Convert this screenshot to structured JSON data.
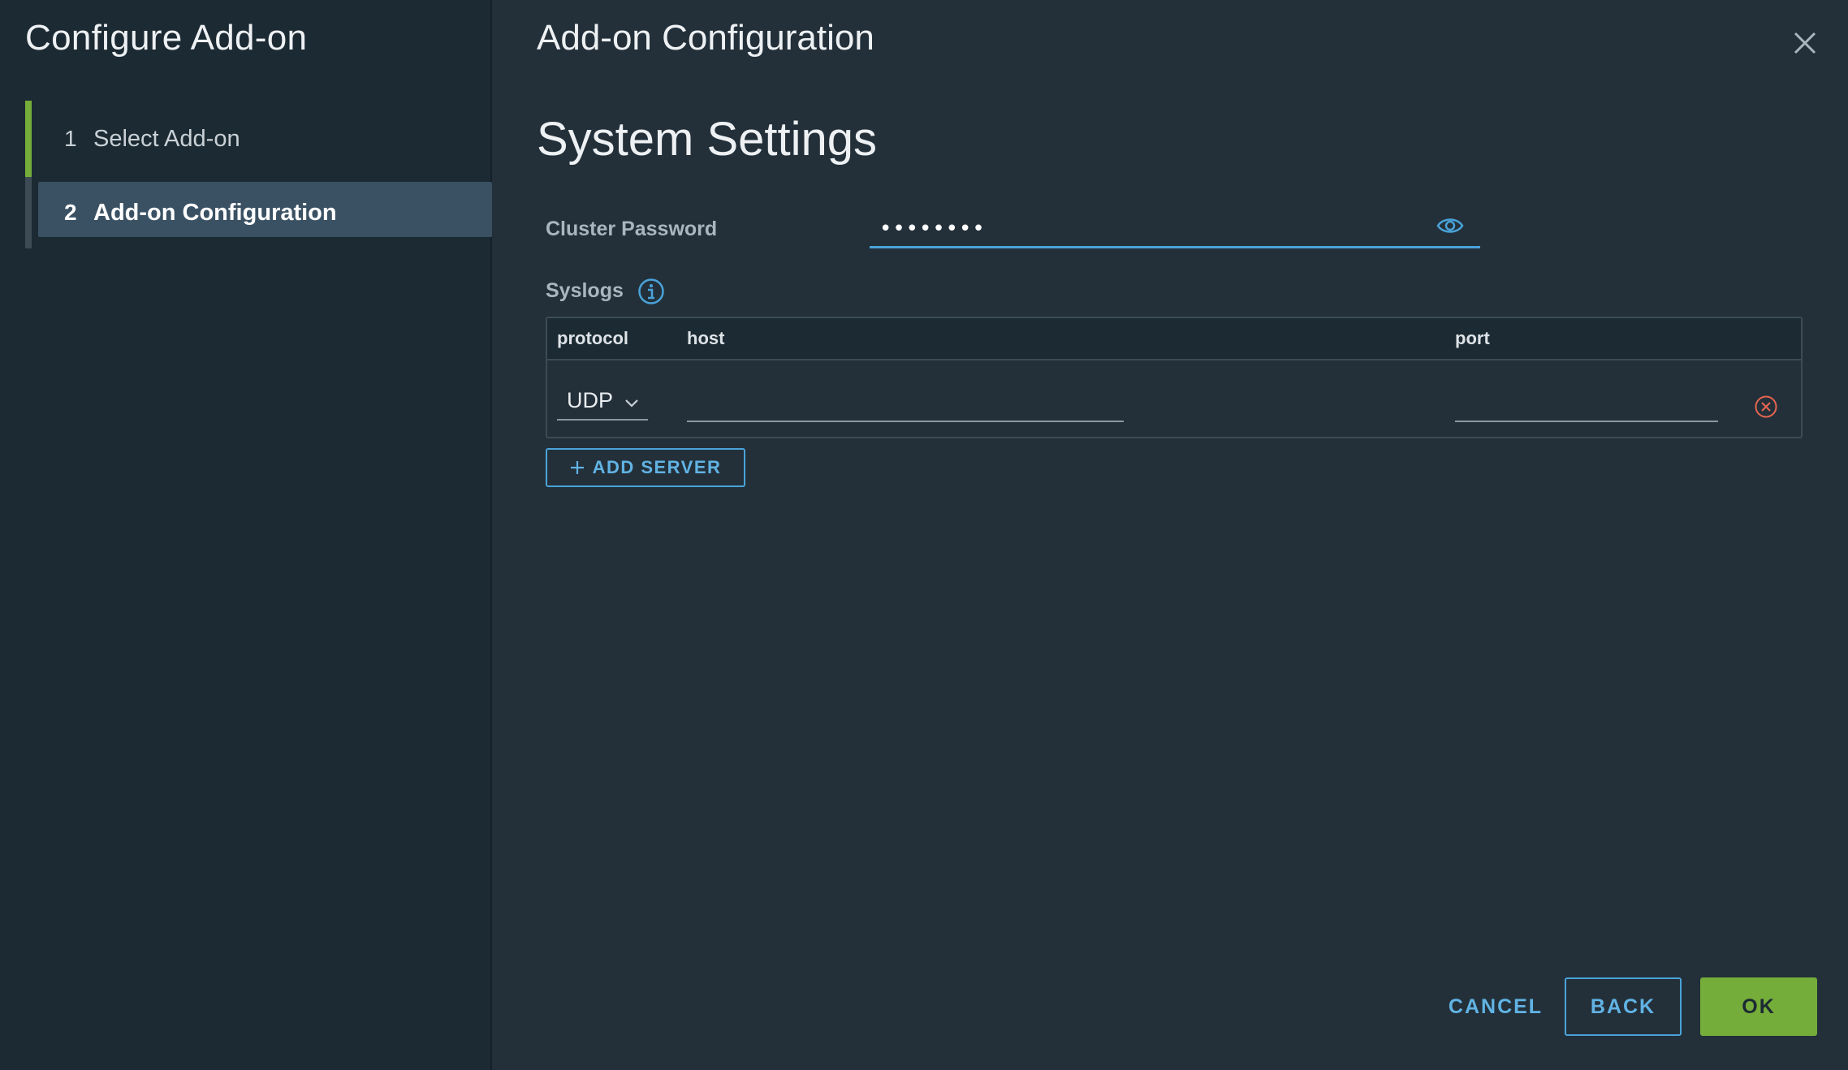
{
  "sidebar": {
    "title": "Configure Add-on",
    "steps": [
      {
        "number": "1",
        "label": "Select Add-on"
      },
      {
        "number": "2",
        "label": "Add-on Configuration"
      }
    ]
  },
  "main": {
    "title": "Add-on Configuration",
    "section_title": "System Settings",
    "cluster_password": {
      "label": "Cluster Password",
      "value": "••••••••"
    },
    "syslogs": {
      "label": "Syslogs",
      "columns": {
        "protocol": "protocol",
        "host": "host",
        "port": "port"
      },
      "rows": [
        {
          "protocol": "UDP",
          "host": "",
          "port": ""
        }
      ],
      "add_button": "ADD SERVER"
    }
  },
  "footer": {
    "cancel": "CANCEL",
    "back": "BACK",
    "ok": "OK"
  },
  "icons": {
    "close": "close-icon",
    "password_toggle": "eye-icon",
    "info": "info-icon",
    "dropdown": "chevron-down-icon",
    "remove": "remove-circle-icon",
    "add": "plus-icon"
  },
  "colors": {
    "background": "#23303a",
    "sidebar": "#1c2a33",
    "accent": "#49a3d9",
    "success": "#75ad3a",
    "danger": "#e5654f"
  }
}
